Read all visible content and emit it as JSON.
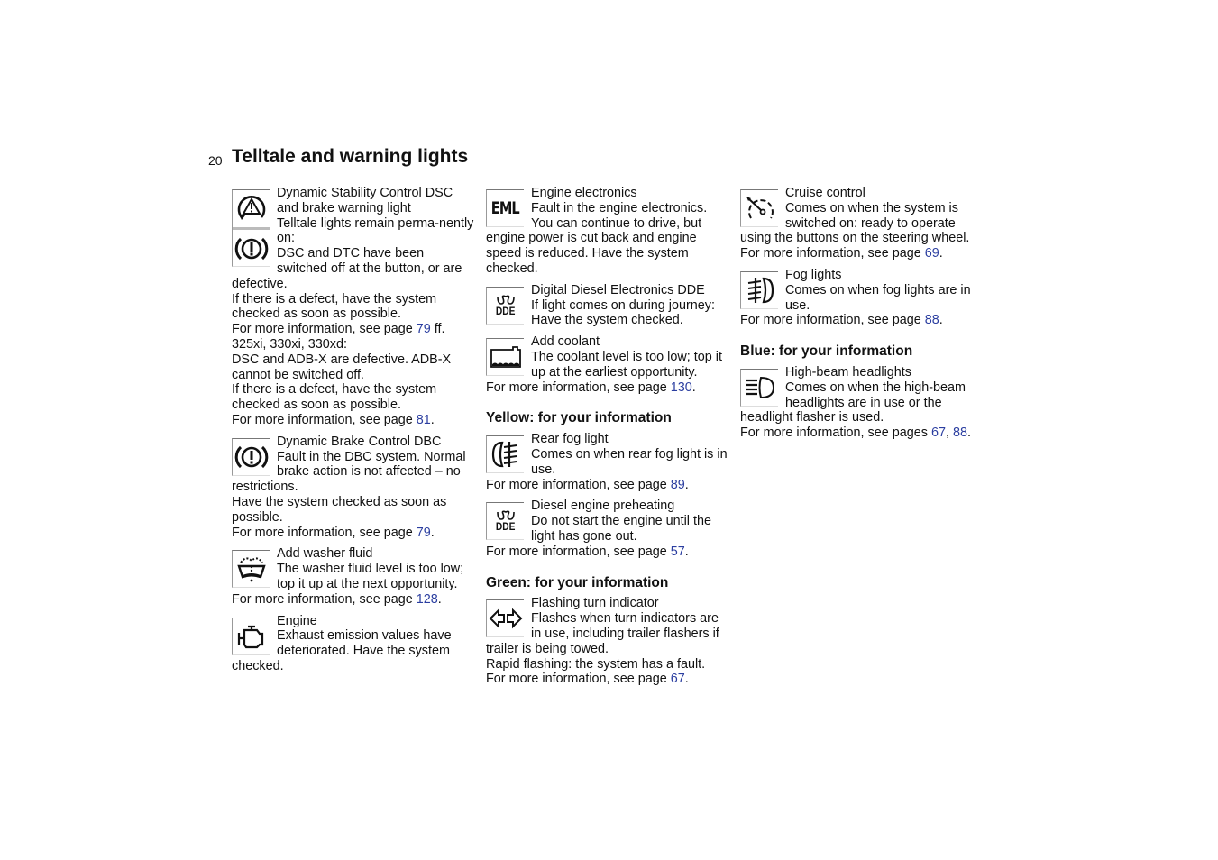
{
  "page": {
    "number": "20",
    "title": "Telltale and warning lights",
    "link_color": "#2b3ea0"
  },
  "columns": {
    "col1": {
      "dsc": {
        "icon": [
          "dsc-warning-triangle-icon",
          "brake-warning-icon"
        ],
        "title": "Dynamic Stability Control DSC and brake warning light",
        "text1": "Telltale lights remain perma-nently on:",
        "text2": "DSC and DTC have been switched off at the button, or are defective.",
        "text3": "If there is a defect, have the system checked as soon as possible.",
        "more1_prefix": "For more information, see page ",
        "more1_page": "79",
        "more1_suffix": " ff.",
        "models": "325xi, 330xi, 330xd:",
        "text4": "DSC and ADB-X are defective. ADB-X cannot be switched off.",
        "text5": "If there is a defect, have the system checked as soon as possible.",
        "more2_prefix": "For more information, see page ",
        "more2_page": "81",
        "more2_suffix": "."
      },
      "dbc": {
        "icon": "brake-warning-icon",
        "title": "Dynamic Brake Control DBC",
        "text1": "Fault in the DBC system. Normal brake action is not affected – no restrictions.",
        "text2": "Have the system checked as soon as possible.",
        "more_prefix": "For more information, see page ",
        "more_page": "79",
        "more_suffix": "."
      },
      "washer": {
        "icon": "washer-fluid-icon",
        "title": "Add washer fluid",
        "text1": "The washer fluid level is too low; top it up at the next opportunity.",
        "more_prefix": "For more information, see page ",
        "more_page": "128",
        "more_suffix": "."
      },
      "engine": {
        "icon": "engine-icon",
        "title": "Engine",
        "text1": "Exhaust emission values have deteriorated. Have the system checked."
      }
    },
    "col2": {
      "eml": {
        "icon": "eml-icon",
        "icon_text": "EML",
        "title": "Engine electronics",
        "text1": "Fault in the engine electronics. You can continue to drive, but engine power is cut back and engine speed is reduced. Have the system checked."
      },
      "dde": {
        "icon": "dde-glow-plug-icon",
        "icon_text": "DDE",
        "title": "Digital Diesel Electronics DDE",
        "text1": "If light comes on during journey: Have the system checked."
      },
      "coolant": {
        "icon": "coolant-icon",
        "title": "Add coolant",
        "text1": "The coolant level is too low; top it up at the earliest opportunity.",
        "more_prefix": "For more information, see page ",
        "more_page": "130",
        "more_suffix": "."
      },
      "yellow_heading": "Yellow: for your information",
      "rear_fog": {
        "icon": "rear-fog-light-icon",
        "title": "Rear fog light",
        "text1": "Comes on when rear fog light is in use.",
        "more_prefix": "For more information, see page ",
        "more_page": "89",
        "more_suffix": "."
      },
      "preheat": {
        "icon": "dde-glow-plug-icon",
        "icon_text": "DDE",
        "title": "Diesel engine preheating",
        "text1": "Do not start the engine until the light has gone out.",
        "more_prefix": "For more information, see page ",
        "more_page": "57",
        "more_suffix": "."
      },
      "green_heading": "Green: for your information",
      "turn": {
        "icon": "turn-indicator-icon",
        "title": "Flashing turn indicator",
        "text1": "Flashes when turn indicators are in use, including trailer flashers if trailer is being towed.",
        "text2": "Rapid flashing: the system has a fault.",
        "more_prefix": "For more information, see page ",
        "more_page": "67",
        "more_suffix": "."
      }
    },
    "col3": {
      "cruise": {
        "icon": "cruise-control-icon",
        "title": "Cruise control",
        "text1": "Comes on when the system is switched on: ready to operate using the buttons on the steering wheel.",
        "more_prefix": "For more information, see page ",
        "more_page": "69",
        "more_suffix": "."
      },
      "fog": {
        "icon": "fog-light-icon",
        "title": "Fog lights",
        "text1": "Comes on when fog lights are in use.",
        "more_prefix": "For more information, see page ",
        "more_page": "88",
        "more_suffix": "."
      },
      "blue_heading": "Blue: for your information",
      "highbeam": {
        "icon": "high-beam-icon",
        "title": "High-beam headlights",
        "text1": "Comes on when the high-beam headlights are in use or the headlight flasher is used.",
        "more_prefix": "For more information, see pages ",
        "more_page1": "67",
        "more_sep": ", ",
        "more_page2": "88",
        "more_suffix": "."
      }
    }
  }
}
